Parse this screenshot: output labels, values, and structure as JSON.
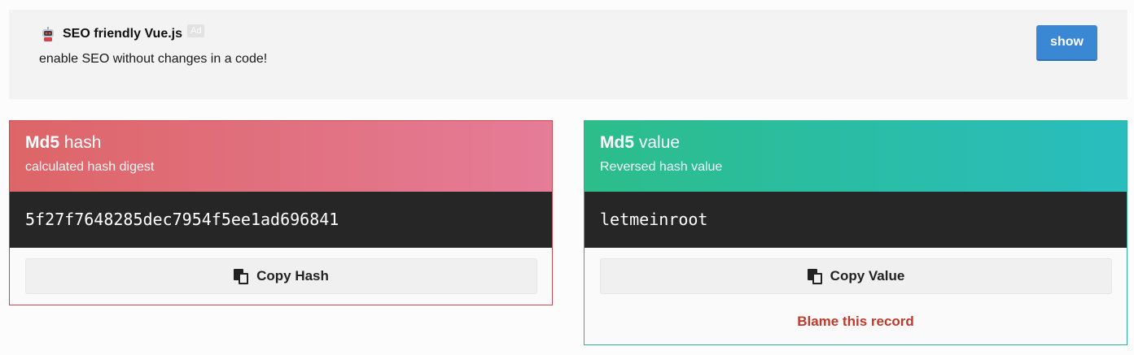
{
  "ad": {
    "title": "SEO friendly Vue.js",
    "badge": "Ad",
    "description": "enable SEO without changes in a code!",
    "show_label": "show",
    "icon": "robot-icon"
  },
  "hash_card": {
    "title_bold": "Md5",
    "title_rest": " hash",
    "subtitle": "calculated hash digest",
    "value": "5f27f7648285dec7954f5ee1ad696841",
    "copy_label": "Copy Hash",
    "copy_icon": "copy-icon"
  },
  "value_card": {
    "title_bold": "Md5",
    "title_rest": " value",
    "subtitle": "Reversed hash value",
    "value": "letmeinroot",
    "copy_label": "Copy Value",
    "copy_icon": "copy-icon",
    "blame_label": "Blame this record"
  },
  "colors": {
    "show_button": "#3a88d4",
    "hash_gradient_start": "#dd6567",
    "hash_gradient_end": "#e57c98",
    "value_gradient_start": "#2cbd8a",
    "value_gradient_end": "#29bdbf",
    "code_bg": "#262626",
    "blame": "#c0392b"
  }
}
